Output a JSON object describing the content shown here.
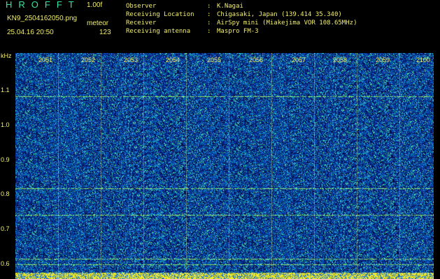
{
  "header": {
    "app_title": "HROFFT",
    "version": "1.00f",
    "filename": "KN9_2504162050.png",
    "timestamp": "25.04.16 20:50",
    "meteor_label": "meteor",
    "meteor_count": "123"
  },
  "info": [
    {
      "key": "Observer",
      "sep": ":",
      "value": "K.Nagai"
    },
    {
      "key": "Receiving Location",
      "sep": ":",
      "value": "Chigasaki, Japan (139.414 35.340)"
    },
    {
      "key": "Receiver",
      "sep": ":",
      "value": "AirSpy mini (Miakejima VOR 108.65MHz)"
    },
    {
      "key": "Receiving antenna",
      "sep": ":",
      "value": "Maspro FM-3"
    }
  ],
  "y_axis": {
    "unit": "kHz",
    "ticks": [
      "1.1",
      "1.0",
      "0.9",
      "0.8",
      "0.7",
      "0.6"
    ]
  },
  "x_axis": {
    "ticks": [
      "2051",
      "2052",
      "2053",
      "2054",
      "2055",
      "2056",
      "2057",
      "2058",
      "2059",
      "2100"
    ]
  },
  "colors": {
    "background": "#000000",
    "label": "#f2ef6a",
    "title": "#3ce6a0",
    "noise_low": "#0a2a9a",
    "noise_high": "#18e0c8",
    "bottom_band": "#ffff40"
  }
}
